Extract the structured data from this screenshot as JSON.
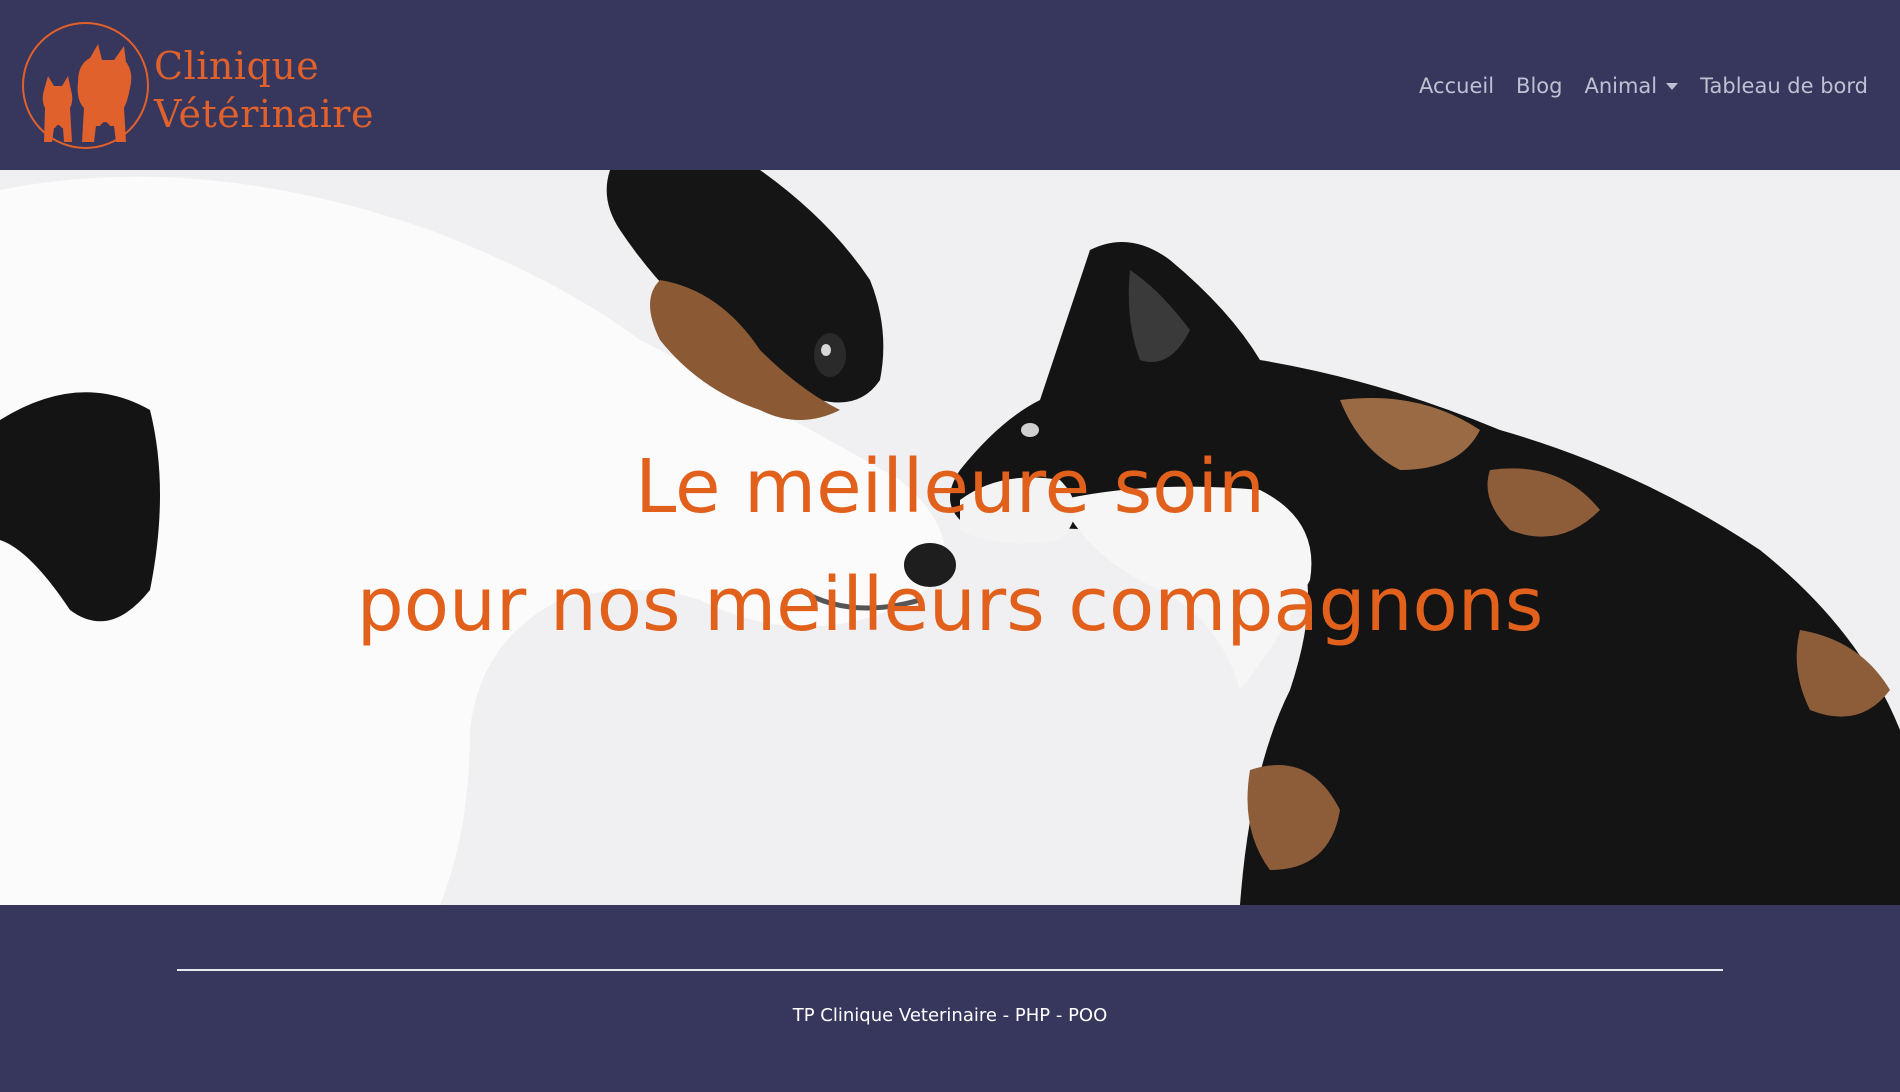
{
  "brand": {
    "line1": "Clinique",
    "line2": "Vétérinaire",
    "icon": "dog-and-cat-logo-icon"
  },
  "nav": {
    "items": [
      {
        "label": "Accueil"
      },
      {
        "label": "Blog"
      },
      {
        "label": "Animal",
        "has_dropdown": true
      },
      {
        "label": "Tableau de bord"
      }
    ]
  },
  "hero": {
    "line1": "Le meilleure soin",
    "line2": "pour nos meilleurs compagnons",
    "image": "dog-and-cat-photo"
  },
  "footer": {
    "text": "TP Clinique Veterinaire - PHP - POO"
  },
  "colors": {
    "navy": "#37365d",
    "accent_orange": "#e1601c",
    "nav_text": "#bfc0d2"
  }
}
